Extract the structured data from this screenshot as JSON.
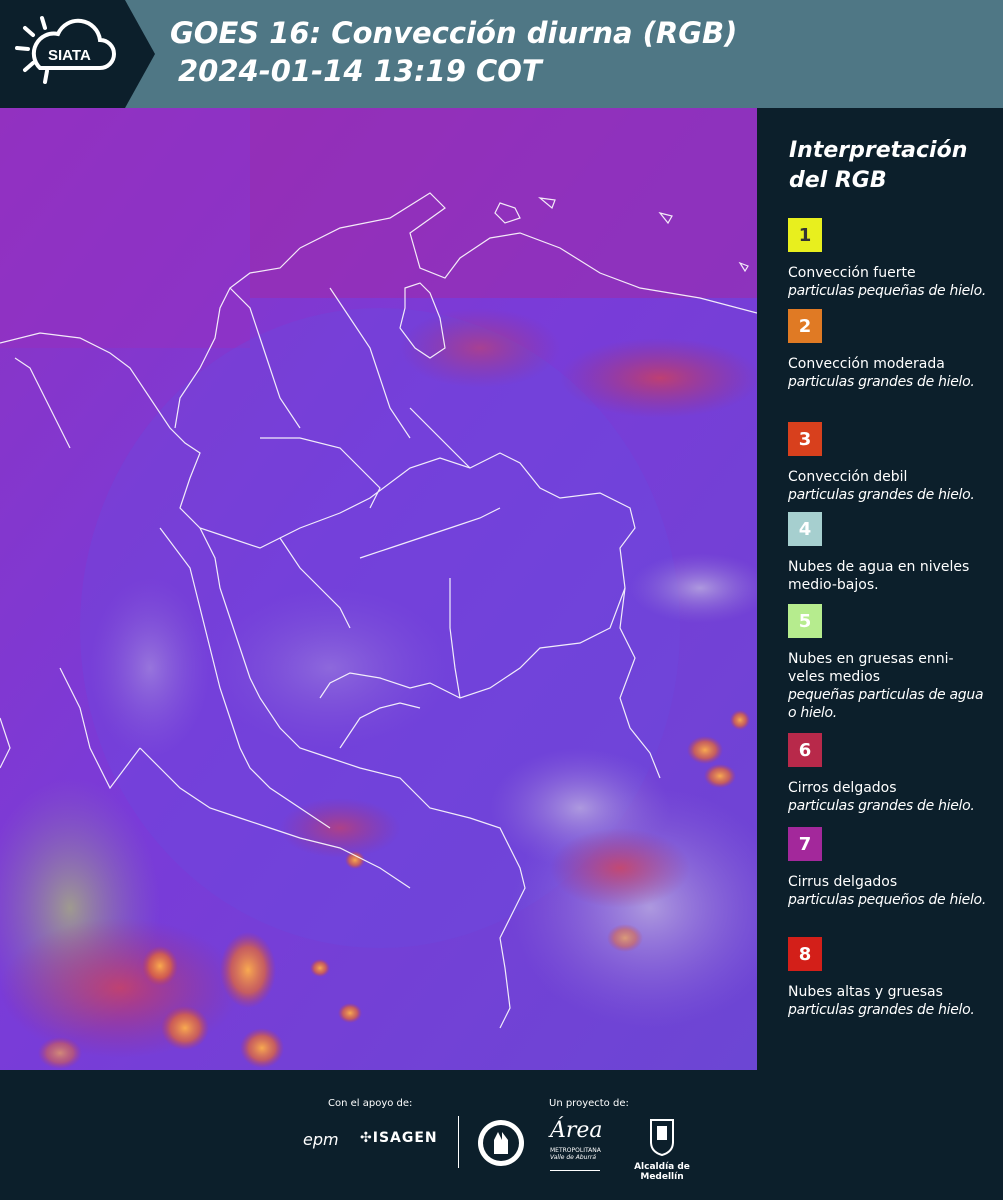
{
  "header": {
    "logo_text": "SIATA",
    "title_line1": "GOES 16: Convección diurna (RGB)",
    "title_line2": "2024-01-14 13:19 COT"
  },
  "legend": {
    "title_line1": "Interpretación",
    "title_line2": "del RGB",
    "items": [
      {
        "number": "1",
        "color": "#e8ef1e",
        "label": "Convección fuerte",
        "sub": "particulas pequeñas de hielo."
      },
      {
        "number": "2",
        "color": "#e07a24",
        "label": "Convección moderada",
        "sub": "particulas grandes de hielo."
      },
      {
        "number": "3",
        "color": "#d8401d",
        "label": "Convección debil",
        "sub": "particulas grandes de hielo."
      },
      {
        "number": "4",
        "color": "#a6cfcf",
        "label": "Nubes de agua en niveles medio-bajos.",
        "sub": ""
      },
      {
        "number": "5",
        "color": "#b6ec8e",
        "label": "Nubes en gruesas enni-veles medios",
        "sub": "pequeñas particulas de agua o hielo."
      },
      {
        "number": "6",
        "color": "#b8294a",
        "label": "Cirros delgados",
        "sub": "particulas grandes de hielo."
      },
      {
        "number": "7",
        "color": "#a3289b",
        "label": "Cirrus delgados",
        "sub": "particulas pequeños de hielo."
      },
      {
        "number": "8",
        "color": "#d31f19",
        "label": "Nubes altas y gruesas",
        "sub": "particulas grandes de hielo."
      }
    ]
  },
  "footer": {
    "support_label": "Con el apoyo de:",
    "project_label": "Un proyecto de:",
    "sponsor1": "epm",
    "sponsor2": "ISAGEN",
    "area_label": "Área",
    "area_sub1": "METROPOLITANA",
    "area_sub2": "Valle de Aburrá",
    "alcaldia": "Alcaldía de Medellín"
  }
}
